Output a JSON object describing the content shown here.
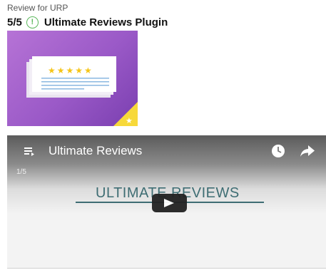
{
  "review": {
    "label": "Review for URP",
    "score": "5/5",
    "info_icon": "!",
    "product_name": "Ultimate Reviews Plugin"
  },
  "thumbnail": {
    "icon": "review-card-with-stars-icon",
    "stars": "★★★★★",
    "badge_star": "★",
    "colors": {
      "bg_from": "#b673d6",
      "bg_to": "#7a3fb0",
      "star": "#f5c518",
      "badge": "#f7d93a"
    }
  },
  "video": {
    "title": "Ultimate Reviews",
    "counter": "1/5",
    "slide_heading": "ULTIMATE REVIEWS",
    "icons": {
      "playlist": "playlist-icon",
      "watch_later": "clock-icon",
      "share": "share-arrow-icon",
      "play": "play-icon"
    },
    "colors": {
      "heading": "#3e6d73",
      "play_button": "#222222"
    }
  }
}
